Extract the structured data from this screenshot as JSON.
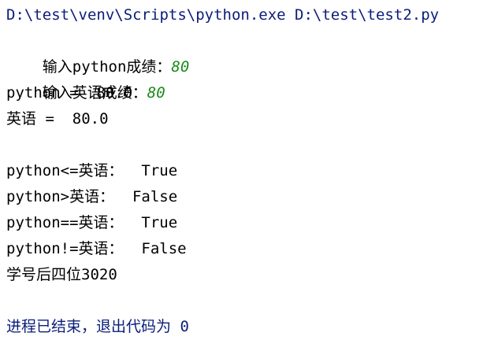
{
  "console": {
    "command_line": "D:\\test\\venv\\Scripts\\python.exe D:\\test\\test2.py",
    "prompt_python": "输入python成绩：",
    "input_python": "80",
    "prompt_english": "输入英语成绩：",
    "input_english": "80",
    "out_python": "python =  80.0",
    "out_english": "英语 =  80.0",
    "cmp_le": "python<=英语：  True",
    "cmp_gt": "python>英语：  False",
    "cmp_eq": "python==英语：  True",
    "cmp_ne": "python!=英语：  False",
    "student_id": "学号后四位3020",
    "exit_message": "进程已结束，退出代码为 0"
  },
  "colors": {
    "command": "#0a1d7a",
    "input": "#1a8a1a",
    "text": "#000000",
    "background": "#ffffff"
  }
}
